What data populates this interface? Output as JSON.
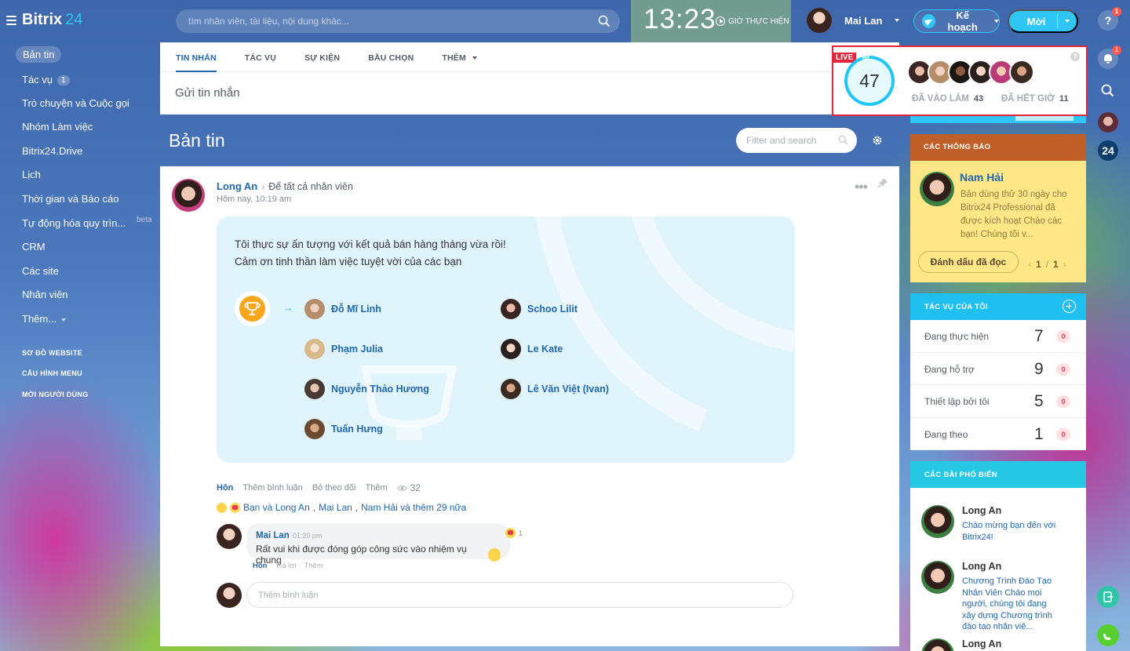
{
  "header": {
    "logo_main": "Bitrix",
    "logo_num": "24",
    "search_placeholder": "tìm nhân viên, tài liệu, nội dung khác...",
    "clock": "13:23",
    "clock_status": "GIỜ THỰC HIỆN",
    "user_name": "Mai Lan",
    "plan_label": "Kế hoạch",
    "invite_label": "Mời"
  },
  "rail": {
    "help_badge": "1",
    "bell_badge": "1",
    "b24_label": "24"
  },
  "menu": {
    "items": [
      {
        "label": "Bản tin"
      },
      {
        "label": "Tác vụ",
        "badge": "1"
      },
      {
        "label": "Trò chuyện và Cuộc gọi"
      },
      {
        "label": "Nhóm Làm việc"
      },
      {
        "label": "Bitrix24.Drive"
      },
      {
        "label": "Lịch"
      },
      {
        "label": "Thời gian và Báo cáo"
      },
      {
        "label": "Tự động hóa quy trìn..."
      },
      {
        "label": "CRM"
      },
      {
        "label": "Các site"
      },
      {
        "label": "Nhân viên"
      },
      {
        "label": "Thêm..."
      }
    ],
    "beta": "beta",
    "small_links": [
      "SƠ ĐỒ WEBSITE",
      "CẤU HÌNH MENU",
      "MỜI NGƯỜI DÙNG"
    ]
  },
  "composer": {
    "tabs": [
      "TIN NHẮN",
      "TÁC VỤ",
      "SỰ KIỆN",
      "BẦU CHỌN",
      "THÊM"
    ],
    "placeholder": "Gửi tin nhắn"
  },
  "live": {
    "tag": "LIVE",
    "count": "47",
    "in_label": "ĐÃ VÀO LÀM",
    "in_count": "43",
    "out_label": "ĐÃ HẾT GIỜ",
    "out_count": "11",
    "help": "?"
  },
  "feed": {
    "title": "Bản tin",
    "filter_placeholder": "Filter and search"
  },
  "post": {
    "author": "Long An",
    "destination": "Để tất cả nhân viên",
    "time": "Hôm nay, 10:19 am",
    "text_line1": "Tôi thực sự ấn tượng với kết quả bán hàng tháng vừa rồi!",
    "text_line2": "Cảm ơn tinh thần làm việc tuyệt vời của các bạn",
    "recipients": [
      "Đỗ Mĩ Linh",
      "Schoo Lilit",
      "Phạm Julia",
      "Le Kate",
      "Nguyễn Thảo Hương",
      "Lê Văn Việt (Ivan)",
      "Tuấn Hưng"
    ],
    "actions": {
      "like": "Hôn",
      "comment": "Thêm bình luận",
      "unfollow": "Bỏ theo dõi",
      "more": "Thêm",
      "views": "32"
    },
    "reactions": {
      "part1": "Bạn và Long An",
      "part2": "Mai Lan",
      "part3": "Nam Hải và thêm 29 nữa"
    },
    "comment": {
      "author": "Mai Lan",
      "time": "01:20 pm",
      "text": "Rất vui khi được đóng góp công sức vào nhiệm vụ chung",
      "react_count": "1",
      "like": "Hôn",
      "reply": "Trả lời",
      "more": "Thêm"
    },
    "add_comment_placeholder": "Thêm bình luận"
  },
  "notices": {
    "title": "CÁC THÔNG BÁO",
    "author": "Nam Hải",
    "text": "Bản dùng thử 30 ngày cho Bitrix24 Professional đã được kích hoạt Chào các bạn! Chúng tôi v...",
    "mark_read": "Đánh dấu đã đọc",
    "page": "1",
    "total": "1"
  },
  "tasks": {
    "title": "TÁC VỤ CỦA TÔI",
    "rows": [
      {
        "label": "Đang thực hiện",
        "num": "7",
        "count": "0"
      },
      {
        "label": "Đang hỗ trợ",
        "num": "9",
        "count": "0"
      },
      {
        "label": "Thiết lập bởi tôi",
        "num": "5",
        "count": "0"
      },
      {
        "label": "Đang theo",
        "num": "1",
        "count": "0"
      }
    ]
  },
  "popular": {
    "title": "CÁC BÀI PHỔ BIẾN",
    "items": [
      {
        "author": "Long An",
        "text": "Chào mừng bạn đến với Bitrix24!"
      },
      {
        "author": "Long An",
        "text": "Chương Trình Đào Tạo Nhân Viên Chào mọi người, chúng tôi đang xây dựng Chương trình đào tạo nhân viê..."
      },
      {
        "author": "Long An",
        "text": ""
      }
    ]
  },
  "colors": {
    "accent": "#2fc6f6",
    "link": "#2067b0",
    "live_red": "#e3263c",
    "notice_yellow": "#ffe788",
    "notice_header": "#c05e28"
  }
}
